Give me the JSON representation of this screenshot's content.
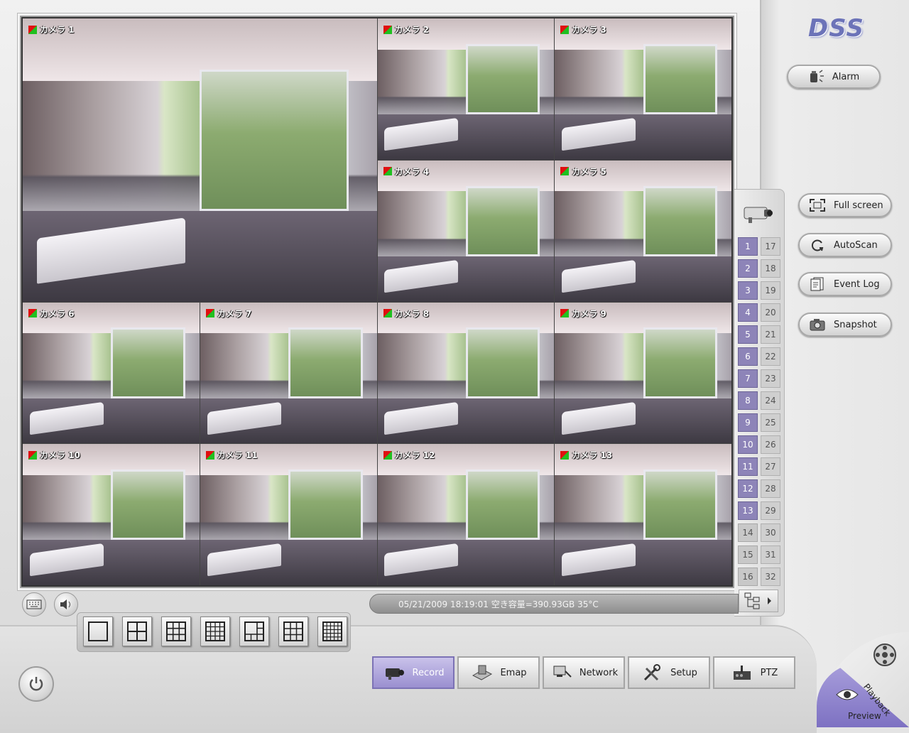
{
  "app": {
    "logo": "DSS"
  },
  "alarm_button": {
    "label": "Alarm",
    "icon": "alarm-icon"
  },
  "cameras": [
    {
      "label": "カメラ 1"
    },
    {
      "label": "カメラ 2"
    },
    {
      "label": "カメラ 3"
    },
    {
      "label": "カメラ 4"
    },
    {
      "label": "カメラ 5"
    },
    {
      "label": "カメラ 6"
    },
    {
      "label": "カメラ 7"
    },
    {
      "label": "カメラ 8"
    },
    {
      "label": "カメラ 9"
    },
    {
      "label": "カメラ 10"
    },
    {
      "label": "カメラ 11"
    },
    {
      "label": "カメラ 12"
    },
    {
      "label": "カメラ 13"
    }
  ],
  "channels": {
    "left": [
      "1",
      "2",
      "3",
      "4",
      "5",
      "6",
      "7",
      "8",
      "9",
      "10",
      "11",
      "12",
      "13",
      "14",
      "15",
      "16"
    ],
    "right": [
      "17",
      "18",
      "19",
      "20",
      "21",
      "22",
      "23",
      "24",
      "25",
      "26",
      "27",
      "28",
      "29",
      "30",
      "31",
      "32"
    ],
    "active_count": 13
  },
  "side_buttons": [
    {
      "label": "Full screen",
      "icon": "fullscreen-icon"
    },
    {
      "label": "AutoScan",
      "icon": "autoscan-icon"
    },
    {
      "label": "Event Log",
      "icon": "event-log-icon"
    },
    {
      "label": "Snapshot",
      "icon": "snapshot-icon"
    }
  ],
  "status": {
    "text": "05/21/2009 18:19:01  空き容量=390.93GB 35°C"
  },
  "layouts": [
    "1x1",
    "2x2",
    "3x3",
    "4x4",
    "1+5",
    "1+7",
    "5x5"
  ],
  "bottom_tabs": [
    {
      "label": "Record",
      "icon": "record-camera-icon",
      "active": true
    },
    {
      "label": "Emap",
      "icon": "emap-icon",
      "active": false
    },
    {
      "label": "Network",
      "icon": "network-icon",
      "active": false
    },
    {
      "label": "Setup",
      "icon": "setup-tools-icon",
      "active": false
    },
    {
      "label": "PTZ",
      "icon": "ptz-icon",
      "active": false
    }
  ],
  "corner": {
    "playback_label": "Playback",
    "preview_label": "Preview"
  },
  "colors": {
    "accent": "#8d84b8",
    "logo": "#6c73b8",
    "rec_red": "#e01010",
    "rec_green": "#20c020"
  }
}
